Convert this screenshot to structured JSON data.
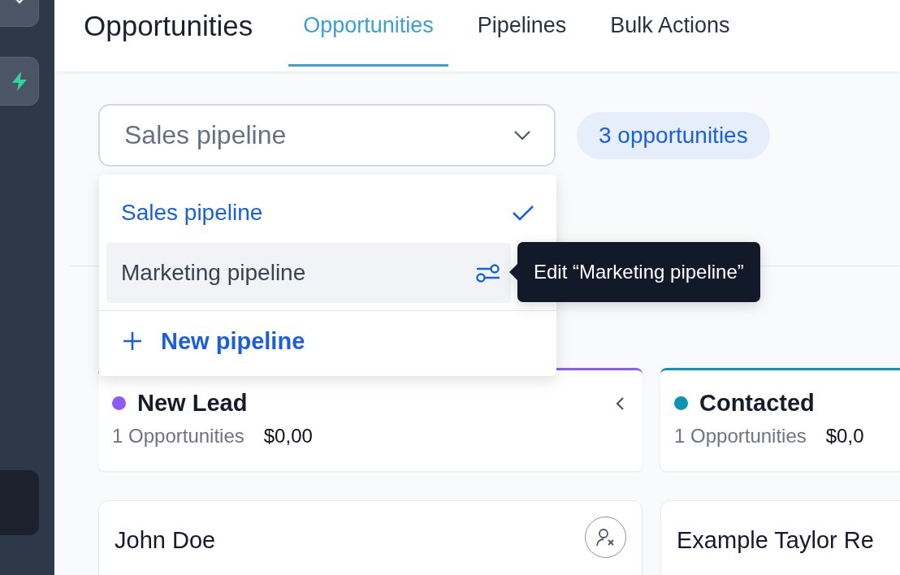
{
  "sidebar": {
    "items": [
      {
        "kind": "chevron",
        "selected": false
      },
      {
        "kind": "bolt",
        "selected": false
      },
      {
        "kind": "blank",
        "selected": true
      }
    ]
  },
  "header": {
    "title": "Opportunities",
    "tabs": [
      {
        "label": "Opportunities",
        "selected": true
      },
      {
        "label": "Pipelines",
        "selected": false
      },
      {
        "label": "Bulk Actions",
        "selected": false
      }
    ]
  },
  "pipeline_select": {
    "value": "Sales pipeline"
  },
  "count_badge": "3 opportunities",
  "dropdown": {
    "items": [
      {
        "label": "Sales pipeline",
        "selected": true,
        "highlighted": false
      },
      {
        "label": "Marketing pipeline",
        "selected": false,
        "highlighted": true
      }
    ],
    "action": "New pipeline"
  },
  "tooltip": "Edit “Marketing pipeline”",
  "columns": [
    {
      "title": "New Lead",
      "color": "#8b5cf6",
      "count": "1 Opportunities",
      "amount": "$0,00",
      "collapse_button": true,
      "cards": [
        {
          "name": "John Doe",
          "assign_button": true
        }
      ]
    },
    {
      "title": "Contacted",
      "color": "#0e94b0",
      "count": "1 Opportunities",
      "amount": "$0,0",
      "cards": [
        {
          "name": "Example Taylor Re"
        }
      ]
    }
  ]
}
